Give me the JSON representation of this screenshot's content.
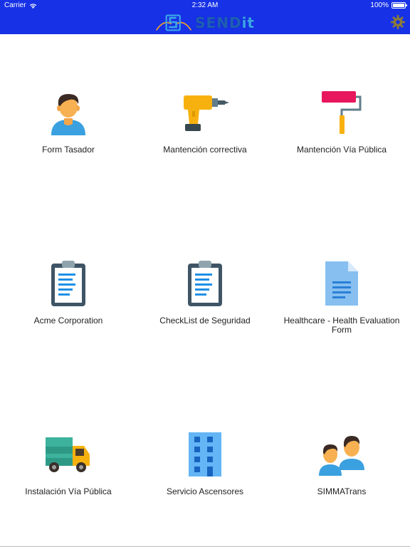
{
  "status_bar": {
    "carrier": "Carrier",
    "time": "2:32 AM",
    "battery": "100%"
  },
  "header": {
    "logo_text_main": "SEND",
    "logo_text_accent": "it",
    "background": "#1631e6"
  },
  "tiles": [
    {
      "label": "Form Tasador",
      "icon": "person-icon"
    },
    {
      "label": "Mantención correctiva",
      "icon": "drill-icon"
    },
    {
      "label": "Mantención Vía Pública",
      "icon": "paint-roller-icon"
    },
    {
      "label": "Acme Corporation",
      "icon": "clipboard-icon"
    },
    {
      "label": "CheckList de Seguridad",
      "icon": "clipboard-icon"
    },
    {
      "label": "Healthcare - Health Evaluation Form",
      "icon": "document-icon"
    },
    {
      "label": "Instalación Vía Pública",
      "icon": "truck-icon"
    },
    {
      "label": "Servicio Ascensores",
      "icon": "building-icon"
    },
    {
      "label": "SIMMATrans",
      "icon": "people-icon"
    }
  ]
}
